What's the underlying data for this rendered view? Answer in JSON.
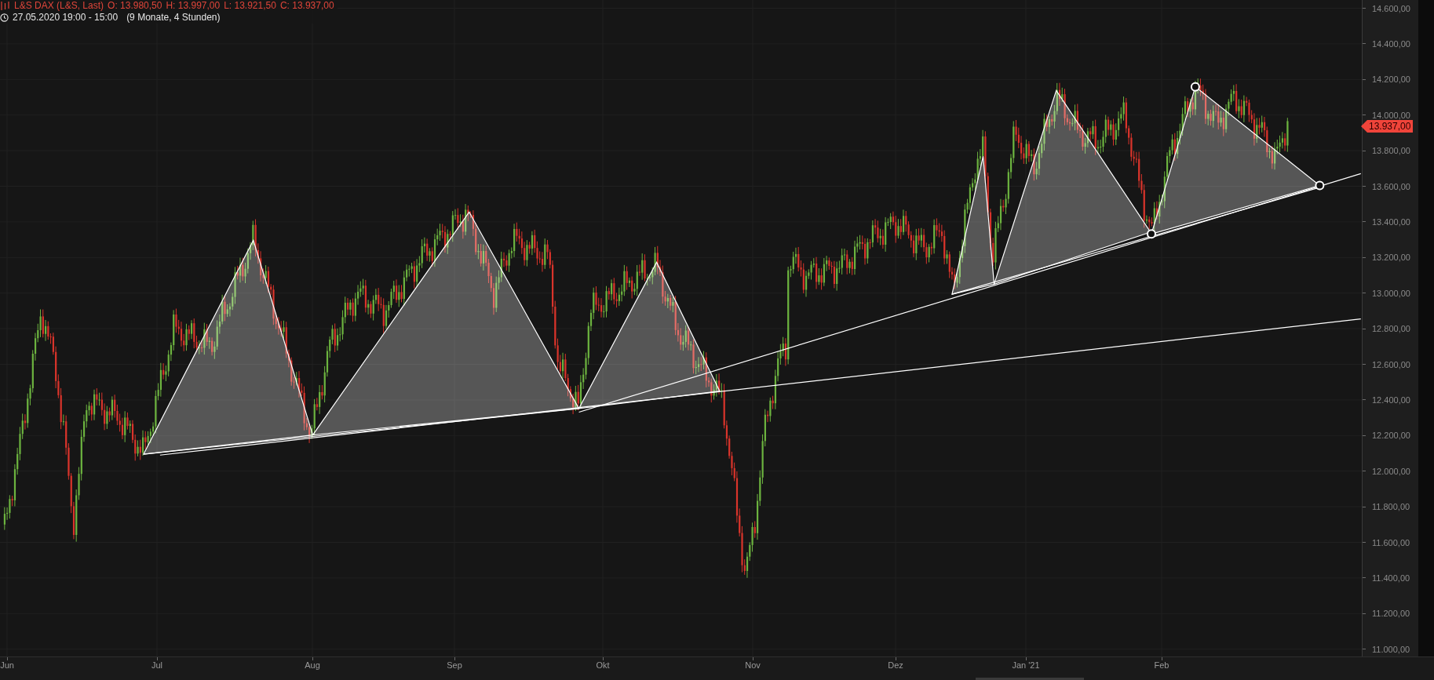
{
  "header": {
    "instrument": "L&S DAX (L&S, Last)",
    "ohlc": [
      "O: 13.980,50",
      "H: 13.997,00",
      "L: 13.921,50",
      "C: 13.937,00"
    ],
    "period": "27.05.2020 19:00 - 15:00",
    "span": "(9 Monate, 4 Stunden)"
  },
  "price_axis": {
    "labels": [
      "14.600,00",
      "14.400,00",
      "14.200,00",
      "14.000,00",
      "13.800,00",
      "13.600,00",
      "13.400,00",
      "13.200,00",
      "13.000,00",
      "12.800,00",
      "12.600,00",
      "12.400,00",
      "12.200,00",
      "12.000,00",
      "11.800,00",
      "11.600,00",
      "11.400,00",
      "11.200,00",
      "11.000,00"
    ],
    "last_price": "13.937,00"
  },
  "time_axis": {
    "labels": [
      "Jun",
      "Jul",
      "Aug",
      "Sep",
      "Okt",
      "Nov",
      "Dez",
      "Jan '21",
      "Feb"
    ]
  }
}
